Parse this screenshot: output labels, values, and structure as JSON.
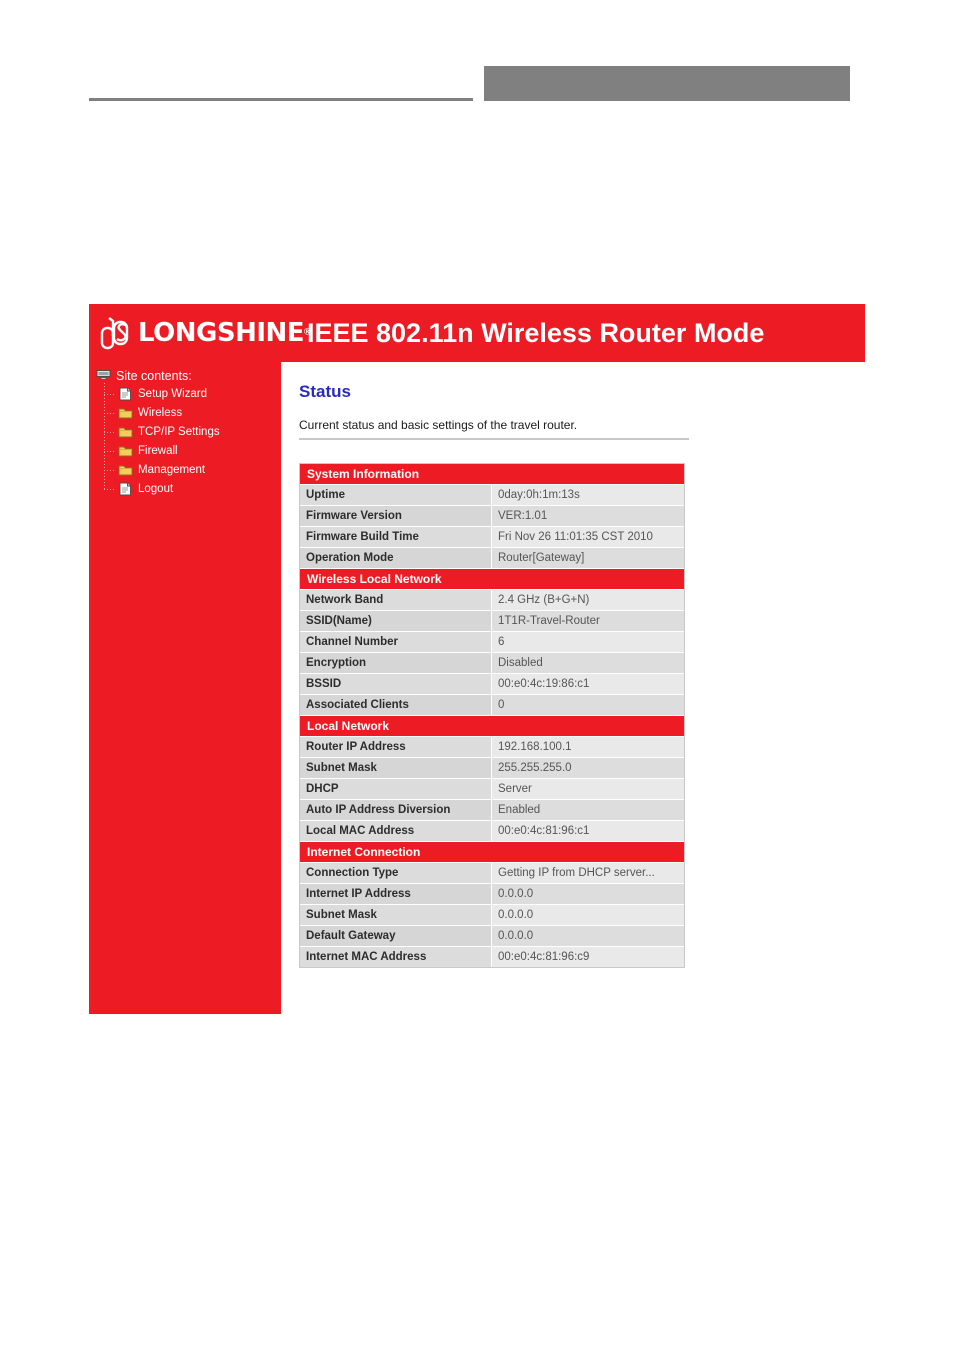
{
  "banner": {
    "logo_text": "LONGSHINE",
    "logo_reg": "®",
    "title": "IEEE 802.11n Wireless Router Mode",
    "brand_color": "#ed1c24"
  },
  "sidebar": {
    "root_label": "Site contents:",
    "items": [
      {
        "label": "Setup Wizard",
        "icon": "page-icon"
      },
      {
        "label": "Wireless",
        "icon": "folder-icon"
      },
      {
        "label": "TCP/IP Settings",
        "icon": "folder-icon"
      },
      {
        "label": "Firewall",
        "icon": "folder-icon"
      },
      {
        "label": "Management",
        "icon": "folder-icon"
      },
      {
        "label": "Logout",
        "icon": "page-icon"
      }
    ]
  },
  "main": {
    "title": "Status",
    "description": "Current status and basic settings of the travel router.",
    "sections": [
      {
        "heading": "System Information",
        "rows": [
          {
            "key": "Uptime",
            "value": "0day:0h:1m:13s"
          },
          {
            "key": "Firmware Version",
            "value": "VER:1.01"
          },
          {
            "key": "Firmware Build Time",
            "value": "Fri Nov 26 11:01:35 CST 2010"
          },
          {
            "key": "Operation Mode",
            "value": "Router[Gateway]"
          }
        ]
      },
      {
        "heading": "Wireless Local Network",
        "rows": [
          {
            "key": "Network Band",
            "value": "2.4 GHz (B+G+N)"
          },
          {
            "key": "SSID(Name)",
            "value": "1T1R-Travel-Router"
          },
          {
            "key": "Channel Number",
            "value": "6"
          },
          {
            "key": "Encryption",
            "value": "Disabled"
          },
          {
            "key": "BSSID",
            "value": "00:e0:4c:19:86:c1"
          },
          {
            "key": "Associated Clients",
            "value": "0"
          }
        ]
      },
      {
        "heading": "Local Network",
        "rows": [
          {
            "key": "Router IP Address",
            "value": "192.168.100.1"
          },
          {
            "key": "Subnet Mask",
            "value": "255.255.255.0"
          },
          {
            "key": "DHCP",
            "value": "Server"
          },
          {
            "key": "Auto IP Address Diversion",
            "value": "Enabled"
          },
          {
            "key": "Local MAC Address",
            "value": "00:e0:4c:81:96:c1"
          }
        ]
      },
      {
        "heading": "Internet Connection",
        "rows": [
          {
            "key": "Connection Type",
            "value": "Getting IP from DHCP server..."
          },
          {
            "key": "Internet IP Address",
            "value": "0.0.0.0"
          },
          {
            "key": "Subnet Mask",
            "value": "0.0.0.0"
          },
          {
            "key": "Default Gateway",
            "value": "0.0.0.0"
          },
          {
            "key": "Internet MAC Address",
            "value": "00:e0:4c:81:96:c9"
          }
        ]
      }
    ]
  }
}
